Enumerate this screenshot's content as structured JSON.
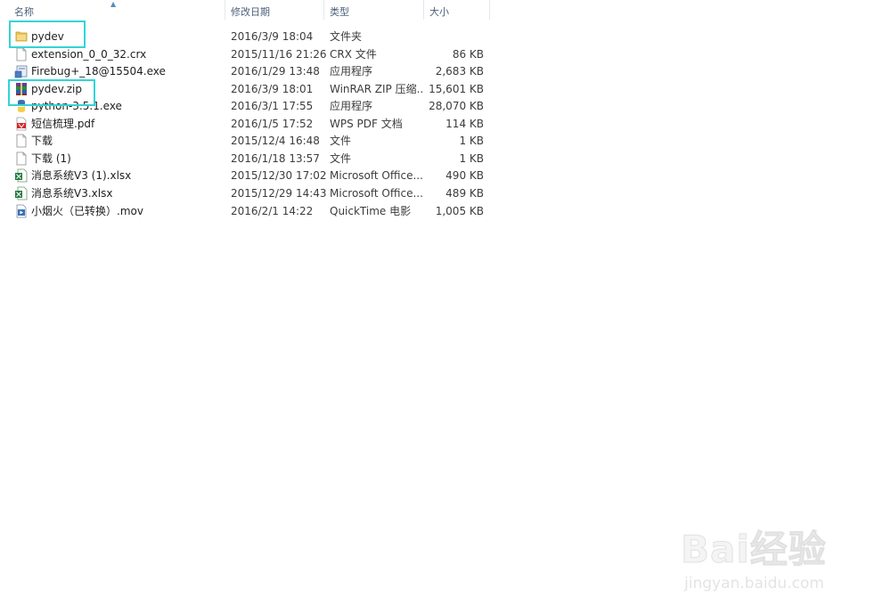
{
  "header": {
    "name_label": "名称",
    "date_label": "修改日期",
    "type_label": "类型",
    "size_label": "大小"
  },
  "files": [
    {
      "name": "pydev",
      "date": "2016/3/9 18:04",
      "type": "文件夹",
      "size": "",
      "icon": "folder-icon"
    },
    {
      "name": "extension_0_0_32.crx",
      "date": "2015/11/16 21:26",
      "type": "CRX 文件",
      "size": "86 KB",
      "icon": "file-icon"
    },
    {
      "name": "Firebug+_18@15504.exe",
      "date": "2016/1/29 13:48",
      "type": "应用程序",
      "size": "2,683 KB",
      "icon": "exe-icon"
    },
    {
      "name": "pydev.zip",
      "date": "2016/3/9 18:01",
      "type": "WinRAR ZIP 压缩...",
      "size": "15,601 KB",
      "icon": "winrar-icon"
    },
    {
      "name": "python-3.5.1.exe",
      "date": "2016/3/1 17:55",
      "type": "应用程序",
      "size": "28,070 KB",
      "icon": "python-icon"
    },
    {
      "name": "短信梳理.pdf",
      "date": "2016/1/5 17:52",
      "type": "WPS PDF 文档",
      "size": "114 KB",
      "icon": "pdf-icon"
    },
    {
      "name": "下载",
      "date": "2015/12/4 16:48",
      "type": "文件",
      "size": "1 KB",
      "icon": "file-icon"
    },
    {
      "name": "下载 (1)",
      "date": "2016/1/18 13:57",
      "type": "文件",
      "size": "1 KB",
      "icon": "file-icon"
    },
    {
      "name": "消息系统V3 (1).xlsx",
      "date": "2015/12/30 17:02",
      "type": "Microsoft Office...",
      "size": "490 KB",
      "icon": "excel-icon"
    },
    {
      "name": "消息系统V3.xlsx",
      "date": "2015/12/29 14:43",
      "type": "Microsoft Office...",
      "size": "489 KB",
      "icon": "excel-icon"
    },
    {
      "name": "小烟火（已转换）.mov",
      "date": "2016/2/1 14:22",
      "type": "QuickTime 电影",
      "size": "1,005 KB",
      "icon": "video-icon"
    }
  ],
  "watermark": {
    "brand": "Bai经验",
    "url": "jingyan.baidu.com"
  },
  "colors": {
    "highlight": "#33d4d7",
    "header_text": "#4c607a"
  }
}
